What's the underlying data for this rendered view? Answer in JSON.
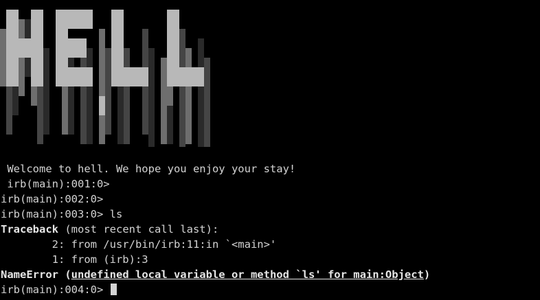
{
  "banner": {
    "word": "HELL",
    "colors": {
      "highlight": "#b8b8b8",
      "mid": "#6e6e6e",
      "dark": "#454545",
      "darker": "#2a2a2a"
    }
  },
  "terminal": {
    "background": "#000000",
    "foreground": "#d3d3d3",
    "welcome": " Welcome to hell. We hope you enjoy your stay!",
    "prompt1": " irb(main):001:0> ",
    "prompt2": "irb(main):002:0> ",
    "prompt3": "irb(main):003:0> ",
    "command3": "ls",
    "traceback_label": "Traceback",
    "traceback_rest": " (most recent call last):",
    "frame2": "        2: from /usr/bin/irb:11:in `<main>'",
    "frame1": "        1: from (irb):3",
    "error_name": "NameError",
    "error_open": " (",
    "error_message": "undefined local variable or method `ls' for main:Object",
    "error_close": ")",
    "prompt4": "irb(main):004:0> "
  }
}
